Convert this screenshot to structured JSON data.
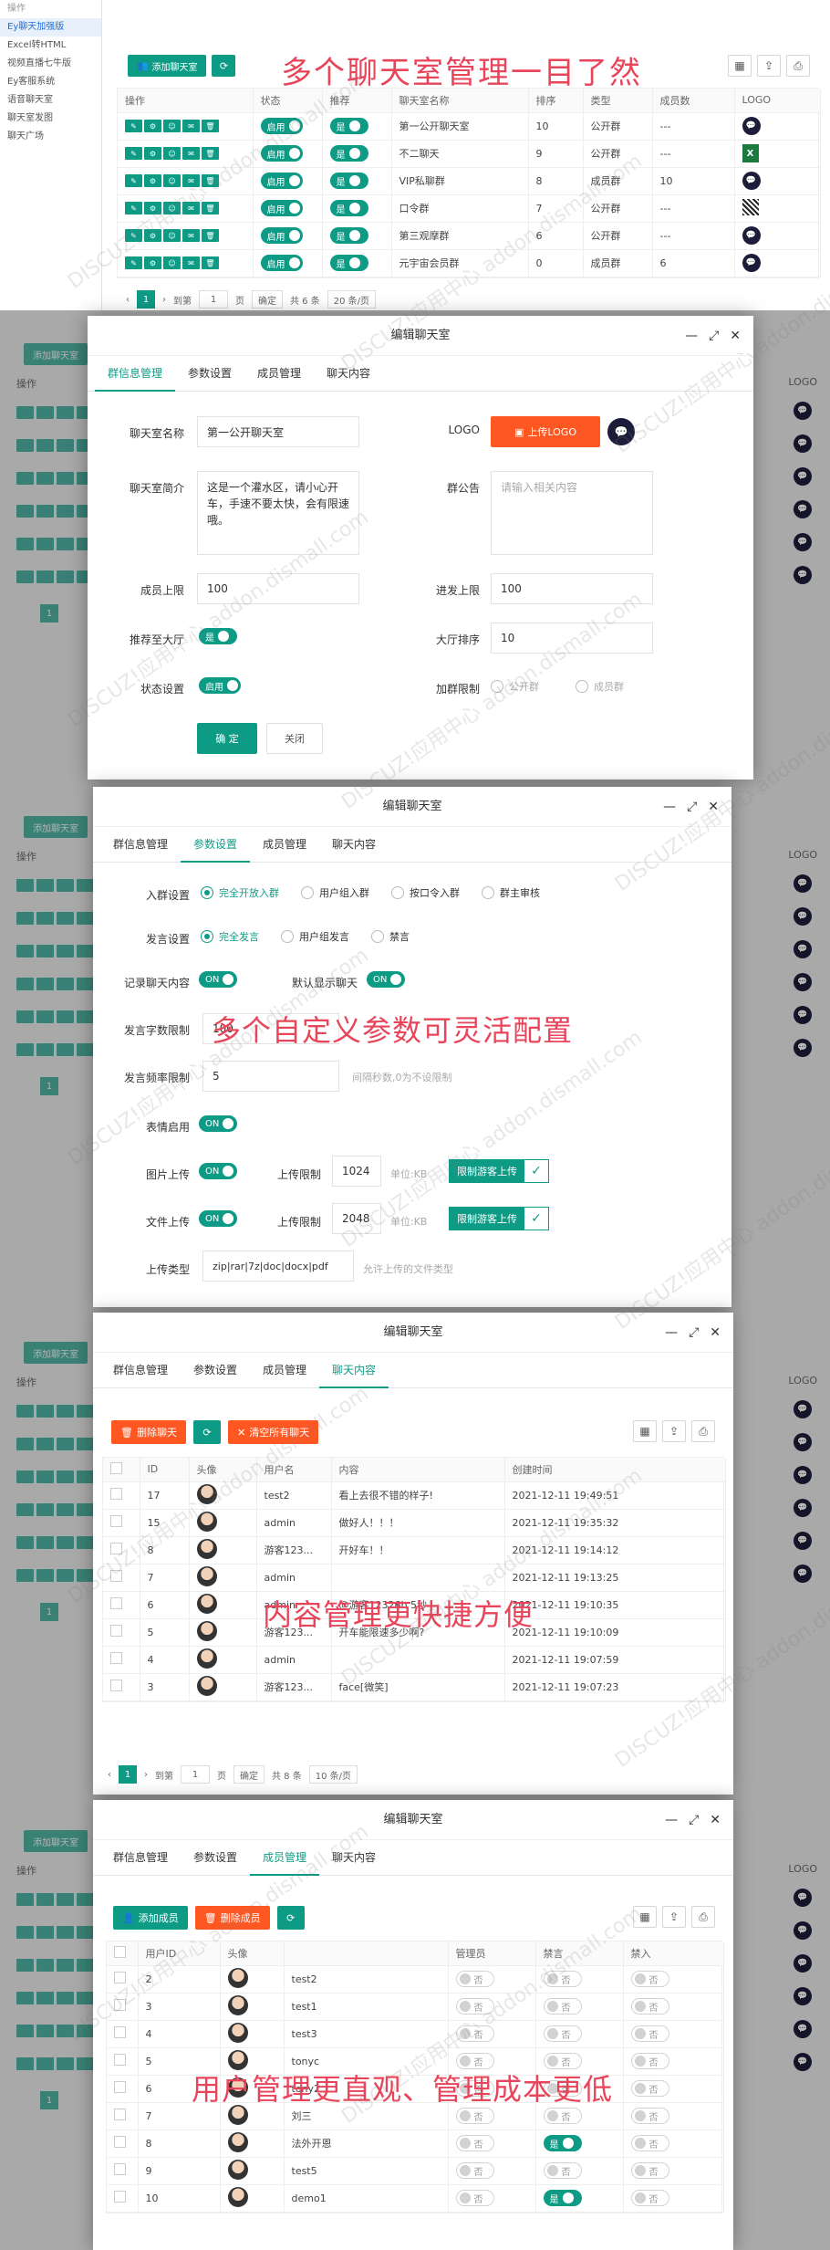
{
  "top": {
    "sidebar": [
      {
        "label": "操作",
        "active": false
      },
      {
        "label": "Ey聊天加强版",
        "active": true
      },
      {
        "label": "Excel转HTML",
        "active": false
      },
      {
        "label": "视频直播七牛版",
        "active": false
      },
      {
        "label": "Ey客服系统",
        "active": false
      },
      {
        "label": "语音聊天室",
        "active": false
      },
      {
        "label": "聊天室发图",
        "active": false
      },
      {
        "label": "聊天广场",
        "active": false
      }
    ],
    "add_button": "添加聊天室",
    "headline": "多个聊天室管理一目了然",
    "columns": [
      "操作",
      "状态",
      "推荐",
      "聊天室名称",
      "排序",
      "类型",
      "成员数",
      "LOGO"
    ],
    "rows": [
      {
        "status": "启用",
        "recommend": "是",
        "name": "第一公开聊天室",
        "sort": "10",
        "type": "公开群",
        "members": "---",
        "logo": "chat"
      },
      {
        "status": "启用",
        "recommend": "是",
        "name": "不二聊天",
        "sort": "9",
        "type": "公开群",
        "members": "---",
        "logo": "excel"
      },
      {
        "status": "启用",
        "recommend": "是",
        "name": "VIP私聊群",
        "sort": "8",
        "type": "成员群",
        "members": "10",
        "logo": "chat"
      },
      {
        "status": "启用",
        "recommend": "是",
        "name": "口令群",
        "sort": "7",
        "type": "公开群",
        "members": "---",
        "logo": "qr"
      },
      {
        "status": "启用",
        "recommend": "是",
        "name": "第三观摩群",
        "sort": "6",
        "type": "公开群",
        "members": "---",
        "logo": "chat"
      },
      {
        "status": "启用",
        "recommend": "是",
        "name": "元宇宙会员群",
        "sort": "0",
        "type": "成员群",
        "members": "6",
        "logo": "chat"
      }
    ],
    "pager": {
      "page": "1",
      "goto": "到第",
      "page_input": "1",
      "page_unit": "页",
      "confirm": "确定",
      "total": "共 6 条",
      "size": "20 条/页"
    }
  },
  "bg": {
    "add_button": "添加聊天室",
    "ops_header": "操作",
    "logo_header": "LOGO",
    "page": "1"
  },
  "modal1": {
    "title": "编辑聊天室",
    "tabs": [
      "群信息管理",
      "参数设置",
      "成员管理",
      "聊天内容"
    ],
    "name_label": "聊天室名称",
    "name_value": "第一公开聊天室",
    "logo_label": "LOGO",
    "upload_button": "上传LOGO",
    "intro_label": "聊天室简介",
    "intro_value": "这是一个灌水区，请小心开车，手速不要太快，会有限速哦。",
    "notice_label": "群公告",
    "notice_placeholder": "请输入相关内容",
    "member_limit_label": "成员上限",
    "member_limit_value": "100",
    "enter_limit_label": "进发上限",
    "enter_limit_value": "100",
    "recommend_label": "推荐至大厅",
    "recommend_value": "是",
    "hall_sort_label": "大厅排序",
    "hall_sort_value": "10",
    "status_label": "状态设置",
    "status_value": "启用",
    "join_limit_label": "加群限制",
    "join_options": [
      "公开群",
      "成员群"
    ],
    "save_button": "确 定",
    "close_button": "关闭"
  },
  "modal2": {
    "title": "编辑聊天室",
    "tabs": [
      "群信息管理",
      "参数设置",
      "成员管理",
      "聊天内容"
    ],
    "entry_label": "入群设置",
    "entry_options": [
      "完全开放入群",
      "用户组入群",
      "按口令入群",
      "群主审核"
    ],
    "speak_label": "发言设置",
    "speak_options": [
      "完全发言",
      "用户组发言",
      "禁言"
    ],
    "record_label": "记录聊天内容",
    "record_value": "ON",
    "default_label": "默认显示聊天",
    "default_value": "ON",
    "caption": "多个自定义参数可灵活配置",
    "maxlen_label": "发言字数限制",
    "maxlen_value": "100",
    "freq_label": "发言频率限制",
    "freq_value": "5",
    "freq_hint": "间隔秒数,0为不设限制",
    "emoji_label": "表情启用",
    "emoji_value": "ON",
    "img_label": "图片上传",
    "img_value": "ON",
    "img_limit_label": "上传限制",
    "img_limit_value": "1024",
    "img_unit": "单位:KB",
    "img_guest": "限制游客上传",
    "file_label": "文件上传",
    "file_value": "ON",
    "file_limit_label": "上传限制",
    "file_limit_value": "2048",
    "file_unit": "单位:KB",
    "file_guest": "限制游客上传",
    "type_label": "上传类型",
    "type_value": "zip|rar|7z|doc|docx|pdf",
    "type_hint": "允许上传的文件类型"
  },
  "modal3": {
    "title": "编辑聊天室",
    "tabs": [
      "群信息管理",
      "参数设置",
      "成员管理",
      "聊天内容"
    ],
    "delete_button": "删除聊天",
    "clear_button": "清空所有聊天",
    "columns": [
      "ID",
      "头像",
      "用户名",
      "内容",
      "创建时间"
    ],
    "rows": [
      {
        "id": "17",
        "user": "test2",
        "content": "看上去很不错的样子!",
        "time": "2021-12-11 19:49:51"
      },
      {
        "id": "15",
        "user": "admin",
        "content": "做好人！！！",
        "time": "2021-12-11 19:35:32"
      },
      {
        "id": "8",
        "user": "游客123...",
        "content": "开好车！！",
        "time": "2021-12-11 19:14:12"
      },
      {
        "id": "7",
        "user": "admin",
        "content": "",
        "time": "2021-12-11 19:13:25"
      },
      {
        "id": "6",
        "user": "admin",
        "content": "@游客12326b 5秒",
        "time": "2021-12-11 19:10:35"
      },
      {
        "id": "5",
        "user": "游客123...",
        "content": "开车能限速多少啊?",
        "time": "2021-12-11 19:10:09"
      },
      {
        "id": "4",
        "user": "admin",
        "content": "",
        "time": "2021-12-11 19:07:59"
      },
      {
        "id": "3",
        "user": "游客123...",
        "content": "face[微笑]",
        "time": "2021-12-11 19:07:23"
      }
    ],
    "caption": "内容管理更快捷方便",
    "pager": {
      "page": "1",
      "goto": "到第",
      "page_input": "1",
      "page_unit": "页",
      "confirm": "确定",
      "total": "共 8 条",
      "size": "10 条/页"
    }
  },
  "modal4": {
    "title": "编辑聊天室",
    "tabs": [
      "群信息管理",
      "参数设置",
      "成员管理",
      "聊天内容"
    ],
    "add_button": "添加成员",
    "delete_button": "删除成员",
    "columns": [
      "用户ID",
      "头像",
      "",
      "管理员",
      "禁言",
      "禁入"
    ],
    "rows": [
      {
        "id": "2",
        "name": "test2",
        "admin": "否",
        "mute": "否",
        "ban": "否"
      },
      {
        "id": "3",
        "name": "test1",
        "admin": "否",
        "mute": "否",
        "ban": "否"
      },
      {
        "id": "4",
        "name": "test3",
        "admin": "否",
        "mute": "否",
        "ban": "否"
      },
      {
        "id": "5",
        "name": "tonyc",
        "admin": "否",
        "mute": "否",
        "ban": "否"
      },
      {
        "id": "6",
        "name": "tony2",
        "admin": "否",
        "mute": "否",
        "ban": "否"
      },
      {
        "id": "7",
        "name": "刘三",
        "admin": "否",
        "mute": "否",
        "ban": "否"
      },
      {
        "id": "8",
        "name": "法外开恩",
        "admin": "否",
        "mute": "是",
        "ban": "否"
      },
      {
        "id": "9",
        "name": "test5",
        "admin": "否",
        "mute": "否",
        "ban": "否"
      },
      {
        "id": "10",
        "name": "demo1",
        "admin": "否",
        "mute": "是",
        "ban": "否"
      }
    ],
    "caption": "用户管理更直观、管理成本更低"
  },
  "watermark": "DISCUZ!应用中心 addon.dismall.com"
}
